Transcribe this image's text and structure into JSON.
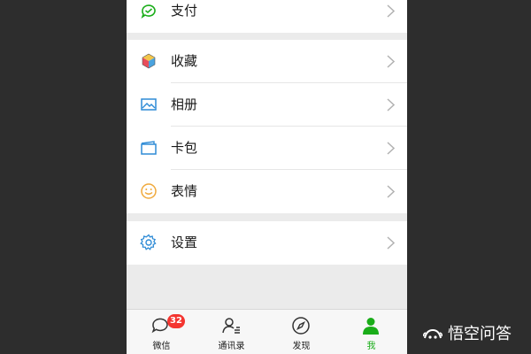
{
  "menu": {
    "groups": [
      {
        "items": [
          {
            "label": "支付",
            "icon": "wallet-icon"
          }
        ]
      },
      {
        "items": [
          {
            "label": "收藏",
            "icon": "favorites-cube-icon"
          },
          {
            "label": "相册",
            "icon": "album-picture-icon"
          },
          {
            "label": "卡包",
            "icon": "card-package-icon"
          },
          {
            "label": "表情",
            "icon": "smiley-face-icon"
          }
        ]
      },
      {
        "items": [
          {
            "label": "设置",
            "icon": "gear-icon"
          }
        ]
      }
    ]
  },
  "tabbar": {
    "tabs": [
      {
        "label": "微信",
        "icon": "chat-bubbles-icon",
        "badge": "32",
        "active": false
      },
      {
        "label": "通讯录",
        "icon": "contacts-icon",
        "active": false
      },
      {
        "label": "发现",
        "icon": "compass-icon",
        "active": false
      },
      {
        "label": "我",
        "icon": "person-icon",
        "active": true
      }
    ]
  },
  "watermark": {
    "text": "悟空问答"
  },
  "colors": {
    "accent_green": "#1aad19",
    "badge_red": "#f43530",
    "background": "#2d2d2d"
  }
}
